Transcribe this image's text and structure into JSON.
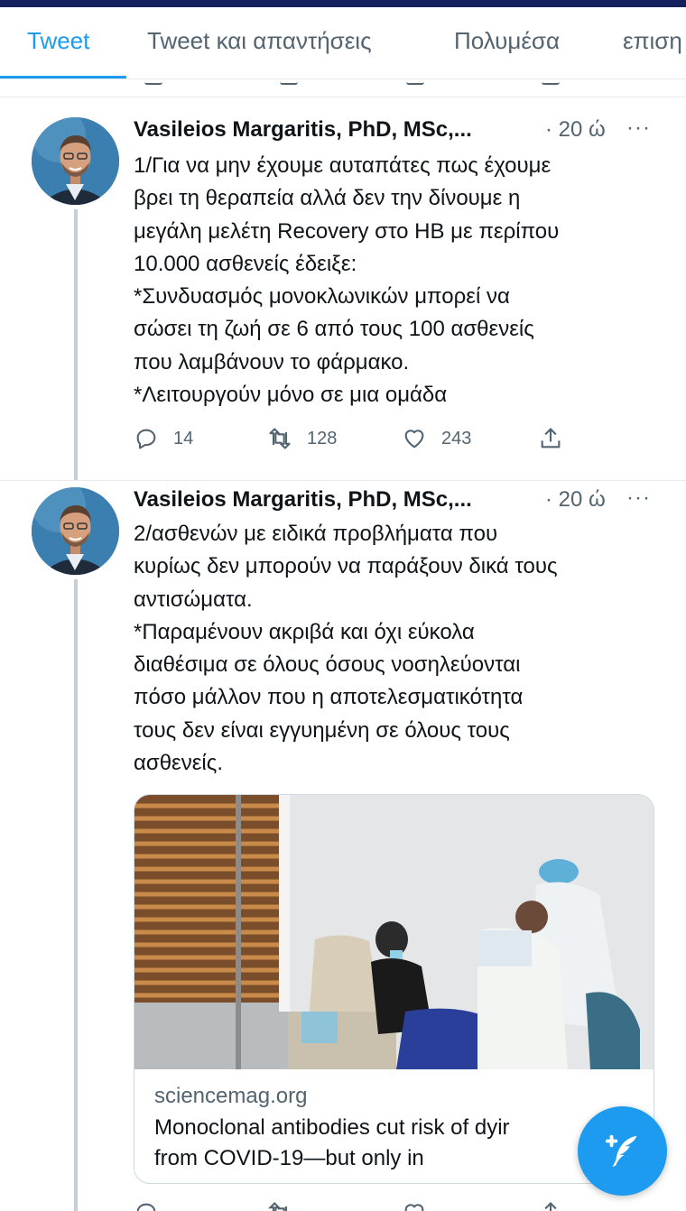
{
  "tabs": [
    {
      "label": "Tweet",
      "active": true
    },
    {
      "label": "Tweet και απαντήσεις",
      "active": false
    },
    {
      "label": "Πολυμέσα",
      "active": false
    },
    {
      "label": "επιση",
      "active": false
    }
  ],
  "tweets": [
    {
      "author": "Vasileios Margaritis, PhD, MSc,...",
      "time": "· 20 ώ",
      "more": "···",
      "text": "1/Για να μην έχουμε αυταπάτες πως έχουμε\nβρει τη θεραπεία αλλά δεν την δίνουμε η\nμεγάλη μελέτη Recovery στο ΗΒ με περίπου\n10.000 ασθενείς έδειξε:\n*Συνδυασμός μονοκλωνικών μπορεί να\nσώσει τη ζωή σε 6 από τους 100 ασθενείς\nπου λαμβάνουν το φάρμακο.\n*Λειτουργούν μόνο σε μια ομάδα",
      "replies": "14",
      "retweets": "128",
      "likes": "243"
    },
    {
      "author": "Vasileios Margaritis, PhD, MSc,...",
      "time": "· 20 ώ",
      "more": "···",
      "text": "2/ασθενών με ειδικά προβλήματα που\nκυρίως δεν μπορούν να παράξουν δικά τους\nαντισώματα.\n*Παραμένουν ακριβά και όχι εύκολα\nδιαθέσιμα σε όλους όσους νοσηλεύονται\nπόσο μάλλον που η αποτελεσματικότητα\nτους δεν είναι εγγυημένη σε όλους τους\nασθενείς.",
      "card": {
        "domain": "sciencemag.org",
        "title": "Monoclonal antibodies cut risk of dyir\nfrom COVID-19—but only in"
      }
    }
  ],
  "icons": {
    "reply": "reply-icon",
    "retweet": "retweet-icon",
    "like": "heart-icon",
    "share": "share-icon",
    "compose": "compose-tweet-icon"
  },
  "colors": {
    "accent": "#1d9bf0",
    "secondary_text": "#536471",
    "top_bar": "#14215e"
  }
}
